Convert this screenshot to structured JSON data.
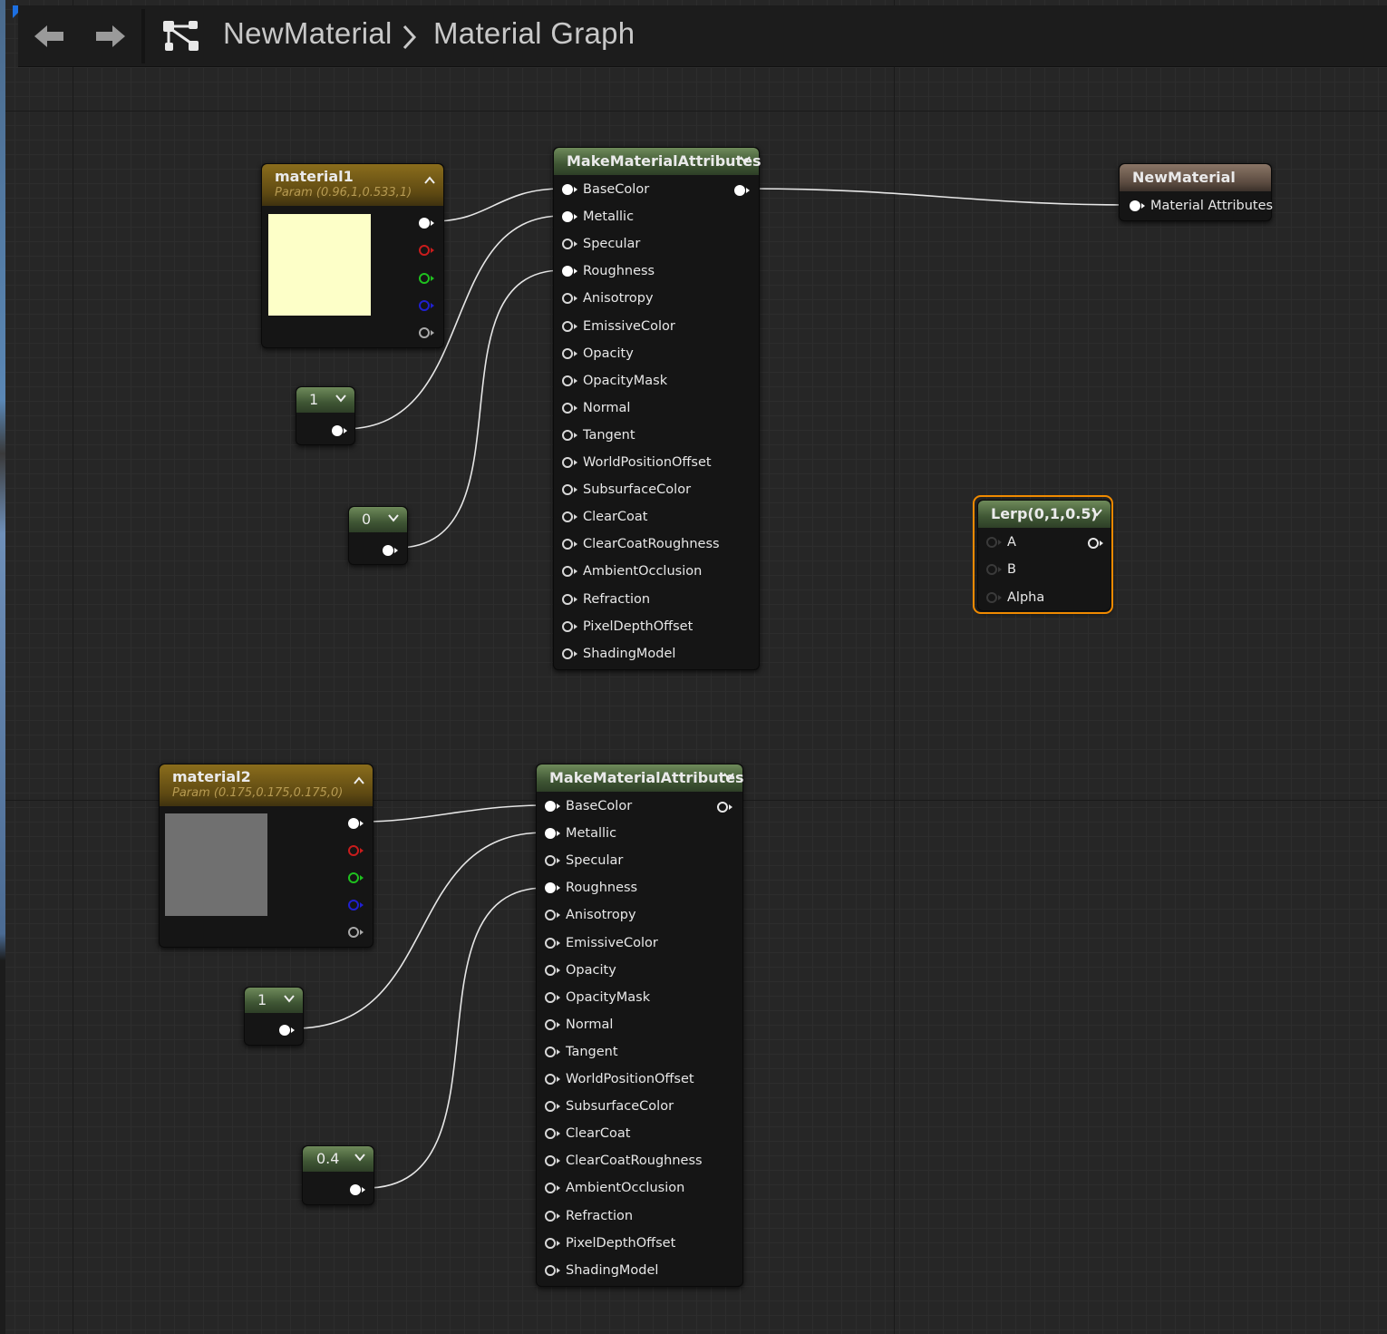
{
  "breadcrumb": {
    "asset": "NewMaterial",
    "graph": "Material Graph"
  },
  "icons": {
    "back": "arrow-left-icon",
    "forward": "arrow-right-icon",
    "graph": "graph-icon",
    "separator": "chevron-right-icon"
  },
  "colors": {
    "pin_red": "#c81c1c",
    "pin_green": "#1fc01f",
    "pin_blue": "#2020d0",
    "selection": "#f08a00",
    "material1_color": "#fdffc8",
    "material2_color": "#707070"
  },
  "attribute_pins": [
    "BaseColor",
    "Metallic",
    "Specular",
    "Roughness",
    "Anisotropy",
    "EmissiveColor",
    "Opacity",
    "OpacityMask",
    "Normal",
    "Tangent",
    "WorldPositionOffset",
    "SubsurfaceColor",
    "ClearCoat",
    "ClearCoatRoughness",
    "AmbientOcclusion",
    "Refraction",
    "PixelDepthOffset",
    "ShadingModel"
  ],
  "nodes": {
    "material1": {
      "title": "material1",
      "subtitle": "Param (0.96,1,0.533,1)"
    },
    "material2": {
      "title": "material2",
      "subtitle": "Param (0.175,0.175,0.175,0)"
    },
    "make1": {
      "title": "MakeMaterialAttributes"
    },
    "make2": {
      "title": "MakeMaterialAttributes"
    },
    "const_metallic1": {
      "value": "1"
    },
    "const_roughness1": {
      "value": "0"
    },
    "const_metallic2": {
      "value": "1"
    },
    "const_roughness2": {
      "value": "0.4"
    },
    "output": {
      "title": "NewMaterial",
      "pin": "Material Attributes"
    },
    "lerp": {
      "title": "Lerp(0,1,0.5)",
      "pins": [
        "A",
        "B",
        "Alpha"
      ]
    }
  }
}
